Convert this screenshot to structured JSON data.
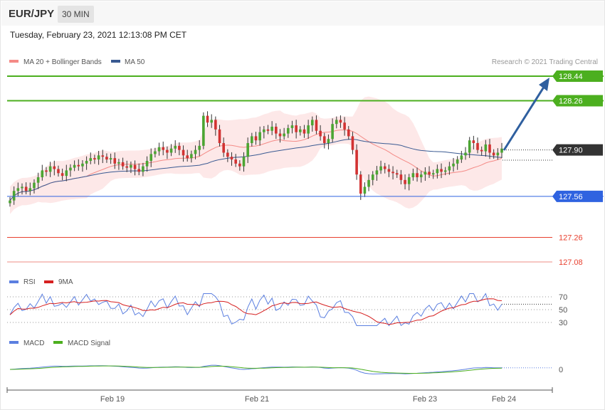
{
  "header": {
    "symbol": "EUR/JPY",
    "timeframe": "30 MIN"
  },
  "datetime": "Tuesday, February 23, 2021 12:13:08 PM CET",
  "credit": "Research © 2021 Trading Central",
  "colors": {
    "resistance": "#4caf1f",
    "support": "#2f63e0",
    "current": "#333333",
    "lower": "#e8402f",
    "lower_soft": "#ef8e85",
    "ma20": "#f48a86",
    "band_fill": "#fde4e4",
    "ma50": "#3a5a92",
    "arrow": "#2f5f9f",
    "candle_up": "#4ba532",
    "candle_down": "#d23232",
    "rsi": "#5b7fe0",
    "rsi_ma": "#d62020",
    "macd": "#5b7fe0",
    "macd_signal": "#4caf1f"
  },
  "chart_data": [
    {
      "type": "candlestick",
      "title": "",
      "legend": [
        "MA 20 + Bollinger Bands",
        "MA 50"
      ],
      "ylim": [
        126.9,
        128.6
      ],
      "x_ticks": [
        "Feb 19",
        "Feb 21",
        "Feb 23",
        "Feb 24"
      ],
      "levels": [
        {
          "label": "128.44",
          "value": 128.44,
          "kind": "resistance"
        },
        {
          "label": "128.26",
          "value": 128.26,
          "kind": "resistance"
        },
        {
          "label": "127.90",
          "value": 127.9,
          "kind": "current"
        },
        {
          "label": "127.56",
          "value": 127.56,
          "kind": "support"
        },
        {
          "label": "127.26",
          "value": 127.26,
          "kind": "lower"
        },
        {
          "label": "127.08",
          "value": 127.08,
          "kind": "lower_soft"
        }
      ],
      "close": [
        127.53,
        127.6,
        127.62,
        127.63,
        127.6,
        127.62,
        127.66,
        127.7,
        127.75,
        127.74,
        127.78,
        127.76,
        127.73,
        127.71,
        127.75,
        127.77,
        127.79,
        127.78,
        127.8,
        127.82,
        127.84,
        127.83,
        127.86,
        127.85,
        127.83,
        127.84,
        127.8,
        127.81,
        127.78,
        127.77,
        127.79,
        127.76,
        127.74,
        127.78,
        127.82,
        127.87,
        127.89,
        127.92,
        127.9,
        127.88,
        127.91,
        127.93,
        127.9,
        127.86,
        127.84,
        127.87,
        127.9,
        127.93,
        128.15,
        128.1,
        128.12,
        128.05,
        127.95,
        127.88,
        127.85,
        127.83,
        127.8,
        127.78,
        127.85,
        127.95,
        128.0,
        127.97,
        128.03,
        128.05,
        128.04,
        128.07,
        128.02,
        128.0,
        128.02,
        128.06,
        128.08,
        128.03,
        128.05,
        128.02,
        128.08,
        128.12,
        128.04,
        128.0,
        127.95,
        127.98,
        128.09,
        128.12,
        128.1,
        128.05,
        128.0,
        127.9,
        127.72,
        127.58,
        127.63,
        127.68,
        127.72,
        127.75,
        127.78,
        127.76,
        127.74,
        127.73,
        127.72,
        127.68,
        127.65,
        127.7,
        127.73,
        127.7,
        127.72,
        127.74,
        127.72,
        127.73,
        127.76,
        127.74,
        127.75,
        127.78,
        127.8,
        127.83,
        127.86,
        127.88,
        127.97,
        127.95,
        127.9,
        127.89,
        127.94,
        127.88,
        127.86,
        127.88,
        127.91
      ]
    },
    {
      "type": "line",
      "title": "",
      "legend": [
        "RSI",
        "9MA"
      ],
      "ylim": [
        20,
        80
      ],
      "y_ticks": [
        70,
        50,
        30
      ]
    },
    {
      "type": "line",
      "title": "",
      "legend": [
        "MACD",
        "MACD Signal"
      ],
      "ylim": [
        -0.4,
        0.4
      ],
      "y_ticks": [
        0
      ]
    }
  ]
}
